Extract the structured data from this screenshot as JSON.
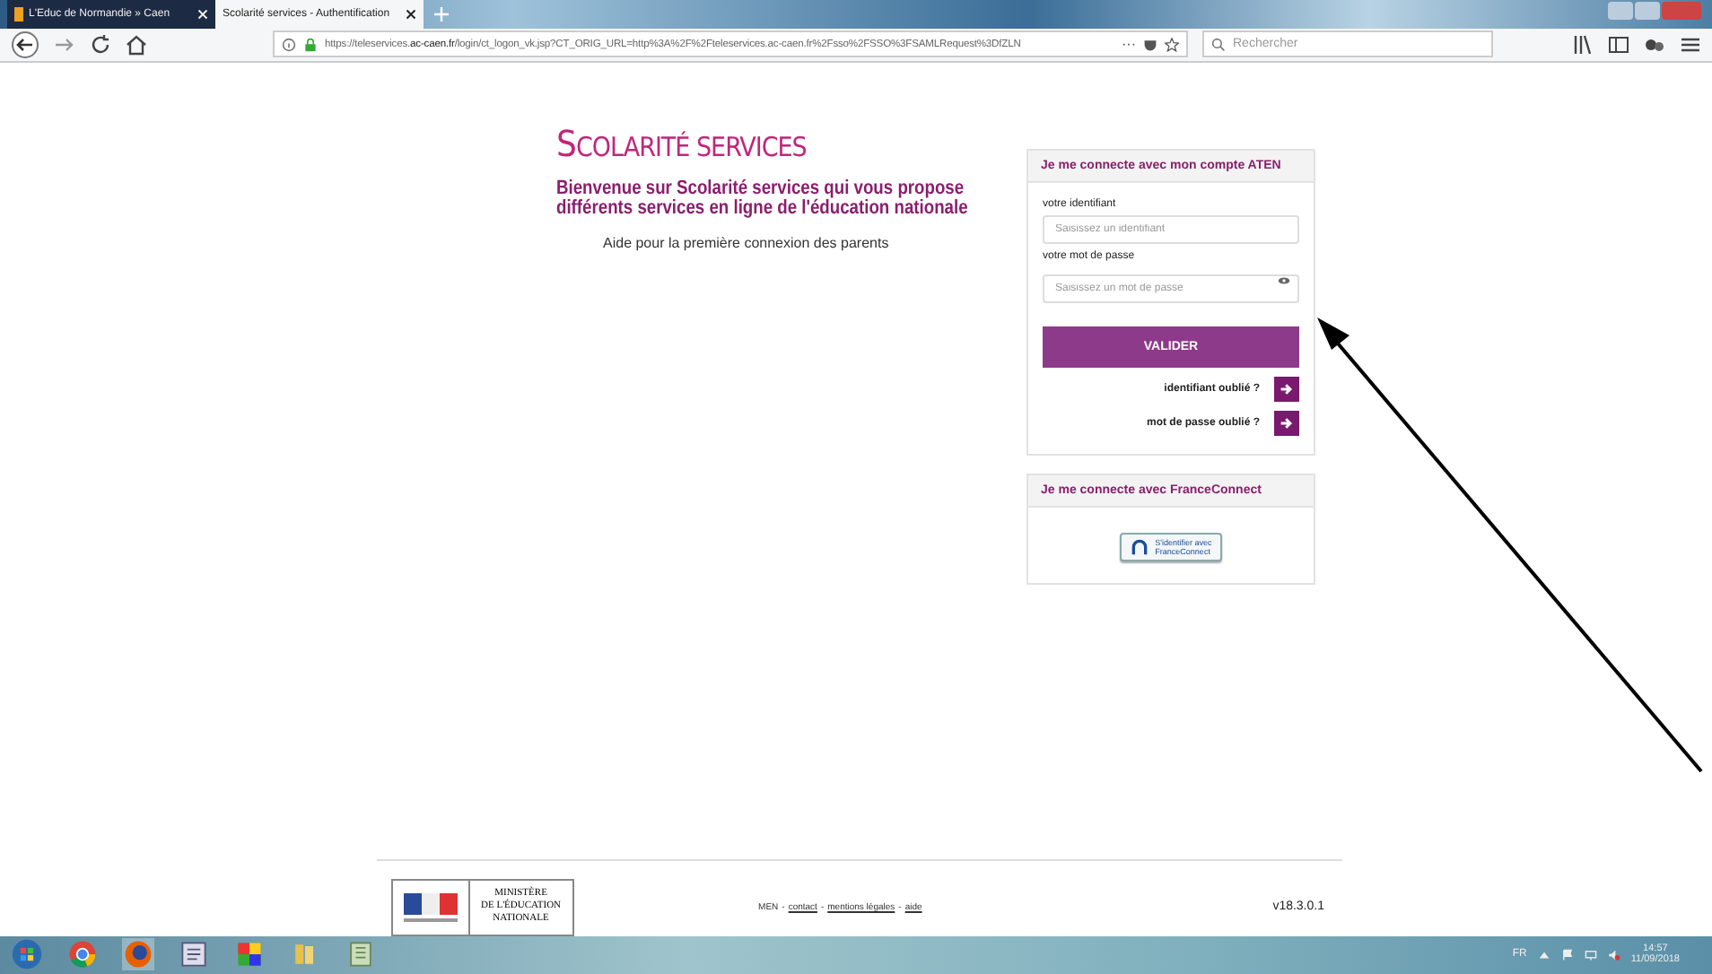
{
  "browser": {
    "tabs": [
      {
        "label": "L'Educ de Normandie » Caen",
        "selected": false
      },
      {
        "label": "Scolarité services - Authentification",
        "selected": true
      }
    ],
    "url": {
      "prefix": "https://teleservices.",
      "domain": "ac-caen.fr",
      "rest": "/login/ct_logon_vk.jsp?CT_ORIG_URL=http%3A%2F%2Fteleservices.ac-caen.fr%2Fsso%2FSSO%3FSAMLRequest%3DfZLN"
    },
    "menu_dots": "···",
    "search": {
      "placeholder": "Rechercher"
    }
  },
  "page": {
    "logo": {
      "first": "S",
      "rest": "COLARITÉ SERVICES"
    },
    "welcome": "Bienvenue sur Scolarité services qui vous propose différents services en ligne de l'éducation nationale",
    "help_link": "Aide pour la première connexion des parents",
    "aten_panel": {
      "title": "Je me connecte avec mon compte ATEN",
      "identifier_label": "votre identifiant",
      "identifier_placeholder": "Saisissez un identifiant",
      "password_label": "votre mot de passe",
      "password_placeholder": "Saisissez un mot de passe",
      "submit": "VALIDER",
      "links": [
        "identifiant oublié ?",
        "mot de passe oublié ?"
      ]
    },
    "franceconnect_panel": {
      "title": "Je me connecte avec FranceConnect",
      "button_line1": "S'identifier avec",
      "button_line2": "FranceConnect"
    },
    "footer": {
      "ministry": [
        "MINISTÈRE",
        "DE L'ÉDUCATION",
        "NATIONALE"
      ],
      "prefix": "MEN",
      "separator": "-",
      "links": [
        "contact",
        "mentions légales",
        "aide"
      ],
      "version": "v18.3.0.1"
    }
  },
  "taskbar": {
    "language": "FR",
    "time": "14:57",
    "date": "11/09/2018"
  }
}
